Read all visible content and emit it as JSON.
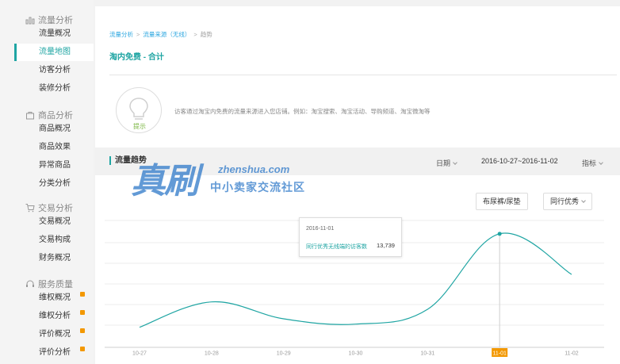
{
  "sidebar": {
    "sections": [
      {
        "title": "流量分析",
        "icon": "bar-chart-icon",
        "items": [
          {
            "label": "流量概况",
            "badge": false,
            "active": false
          },
          {
            "label": "流量地图",
            "badge": false,
            "active": true
          },
          {
            "label": "访客分析",
            "badge": false,
            "active": false
          },
          {
            "label": "装修分析",
            "badge": false,
            "active": false
          }
        ]
      },
      {
        "title": "商品分析",
        "icon": "bag-icon",
        "items": [
          {
            "label": "商品概况",
            "badge": false,
            "active": false
          },
          {
            "label": "商品效果",
            "badge": false,
            "active": false
          },
          {
            "label": "异常商品",
            "badge": false,
            "active": false
          },
          {
            "label": "分类分析",
            "badge": false,
            "active": false
          }
        ]
      },
      {
        "title": "交易分析",
        "icon": "cart-icon",
        "items": [
          {
            "label": "交易概况",
            "badge": false,
            "active": false
          },
          {
            "label": "交易构成",
            "badge": false,
            "active": false
          },
          {
            "label": "财务概况",
            "badge": false,
            "active": false
          }
        ]
      },
      {
        "title": "服务质量",
        "icon": "headset-icon",
        "items": [
          {
            "label": "维权概况",
            "badge": true,
            "active": false
          },
          {
            "label": "维权分析",
            "badge": true,
            "active": false
          },
          {
            "label": "评价概况",
            "badge": true,
            "active": false
          },
          {
            "label": "评价分析",
            "badge": true,
            "active": false
          }
        ]
      }
    ]
  },
  "breadcrumb": {
    "level1": "流量分析",
    "level2": "流量来源（无线）",
    "level3": "趋势",
    "separator": ">"
  },
  "page_title": "淘内免费 - 合计",
  "tip": {
    "label": "提示",
    "description": "访客通过淘宝内免费的流量来源进入您店铺。例如：淘宝搜索、淘宝活动、导购频道、淘宝微淘等"
  },
  "trend": {
    "title": "流量趋势",
    "date_label": "日期",
    "date_range": "2016-10-27~2016-11-02",
    "metric_label": "指标"
  },
  "filters": {
    "category": "布尿裤/尿垫",
    "peer": "同行优秀"
  },
  "tooltip": {
    "date": "2016-11-01",
    "label": "同行优秀无线端的访客数",
    "value": "13,739"
  },
  "watermark": {
    "big": "真刷",
    "domain": "zhenshua.com",
    "cn": "中小卖家交流社区"
  },
  "colors": {
    "accent": "#1fa5a3",
    "link": "#2ea7e0",
    "badge": "#f39800",
    "line": "#1fa5a3"
  },
  "chart_data": {
    "type": "line",
    "categories": [
      "10-27",
      "10-28",
      "10-29",
      "10-30",
      "10-31",
      "11-01",
      "11-02"
    ],
    "series": [
      {
        "values": [
          4900,
          7300,
          5700,
          5200,
          6600,
          13739,
          9900
        ]
      }
    ],
    "highlighted_category": "11-01",
    "grid": true,
    "yaxis_labels_visible": false
  }
}
